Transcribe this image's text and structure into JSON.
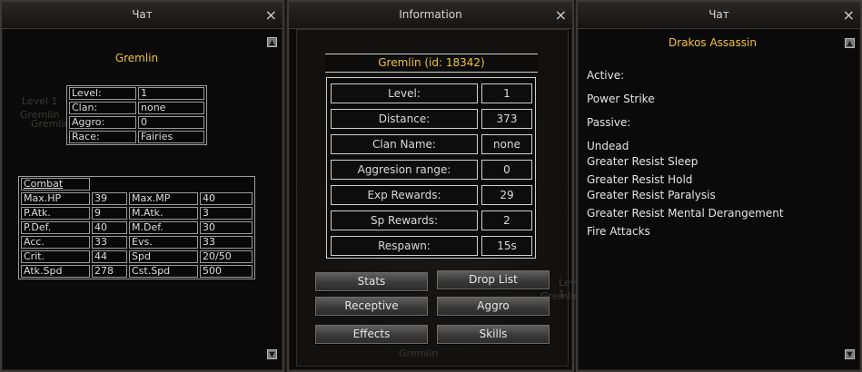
{
  "left_window": {
    "title": "Чат",
    "name": "Gremlin",
    "basic_info": [
      {
        "label": "Level:",
        "value": "1"
      },
      {
        "label": "Clan:",
        "value": "none"
      },
      {
        "label": "Aggro:",
        "value": "0"
      },
      {
        "label": "Race:",
        "value": "Fairies"
      }
    ],
    "combat_title": "Combat",
    "combat_rows": [
      [
        "Max.HP",
        "39",
        "Max.MP",
        "40"
      ],
      [
        "P.Atk.",
        "9",
        "M.Atk.",
        "3"
      ],
      [
        "P.Def.",
        "40",
        "M.Def.",
        "30"
      ],
      [
        "Acc.",
        "33",
        "Evs.",
        "33"
      ],
      [
        "Crit.",
        "44",
        "Spd",
        "20/50"
      ],
      [
        "Atk.Spd",
        "278",
        "Cst.Spd",
        "500"
      ]
    ],
    "ghost_text": [
      "Level 1",
      "Gremlin",
      "Gremlin"
    ]
  },
  "info_window": {
    "title": "Information",
    "header": "Gremlin (id: 18342)",
    "rows": [
      {
        "label": "Level:",
        "value": "1"
      },
      {
        "label": "Distance:",
        "value": "373"
      },
      {
        "label": "Clan Name:",
        "value": "none"
      },
      {
        "label": "Aggresion range:",
        "value": "0"
      },
      {
        "label": "Exp Rewards:",
        "value": "29"
      },
      {
        "label": "Sp Rewards:",
        "value": "2"
      },
      {
        "label": "Respawn:",
        "value": "15s"
      }
    ],
    "buttons": [
      "Stats",
      "Drop List",
      "Receptive",
      "Aggro",
      "Effects",
      "Skills"
    ],
    "ghost_text": [
      "Level 1",
      "Gremlin",
      "Gremlin"
    ]
  },
  "right_window": {
    "title": "Чат",
    "name": "Drakos Assassin",
    "active_label": "Active:",
    "active_skills": [
      "Power Strike"
    ],
    "passive_label": "Passive:",
    "passive_skills": [
      "Undead",
      "Greater Resist Sleep",
      "Greater Resist Hold",
      "Greater Resist Paralysis",
      "Greater Resist Mental Derangement",
      "Fire Attacks"
    ]
  },
  "icons": {
    "close": "×",
    "scroll_up": "▲",
    "scroll_down": "▼"
  },
  "colors": {
    "accent_gold": "#f0c23a",
    "panel_bg": "#0a0a0a",
    "border": "#cfcfcf"
  }
}
